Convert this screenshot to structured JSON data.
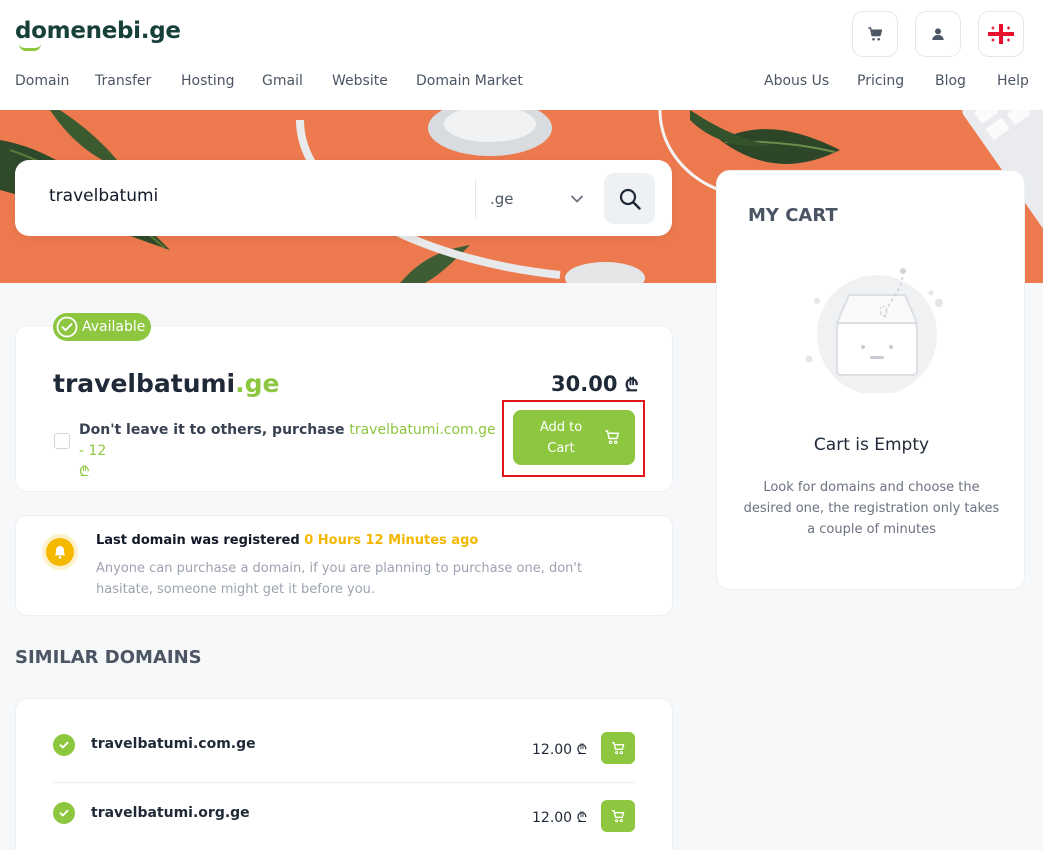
{
  "header": {
    "logo": "domenebi.ge",
    "nav_left": [
      "Domain",
      "Transfer",
      "Hosting",
      "Gmail",
      "Website",
      "Domain Market"
    ],
    "nav_right": [
      "Abous Us",
      "Pricing",
      "Blog",
      "Help"
    ],
    "icons": [
      "cart-icon",
      "user-icon",
      "georgia-flag-icon"
    ]
  },
  "search": {
    "value": "travelbatumi",
    "tld": ".ge"
  },
  "result": {
    "status": "Available",
    "domain_name": "travelbatumi",
    "domain_tld": ".ge",
    "price": "30.00",
    "currency": "₾",
    "upsell_prefix": "Don't leave it to others, purchase",
    "upsell_domain": "travelbatumi.com.ge - 12",
    "upsell_currency": "₾",
    "add_to_cart_label": "Add to\nCart"
  },
  "notice": {
    "title": "Last domain was registered",
    "time": "0 Hours 12 Minutes ago",
    "text": "Anyone can purchase a domain, if you are planning to purchase one, don't hasitate, someone might get it before you."
  },
  "similar": {
    "heading": "SIMILAR DOMAINS",
    "items": [
      {
        "domain": "travelbatumi.com.ge",
        "price": "12.00",
        "currency": "₾"
      },
      {
        "domain": "travelbatumi.org.ge",
        "price": "12.00",
        "currency": "₾"
      }
    ]
  },
  "cart": {
    "title": "MY CART",
    "empty_title": "Cart is Empty",
    "empty_text": "Look for domains and choose the desired one, the registration only takes a couple of minutes"
  },
  "colors": {
    "brand_green": "#8dc63f",
    "dark_green": "#17403a",
    "notice_yellow": "#f5b800",
    "hero_orange": "#ec7a4e"
  }
}
